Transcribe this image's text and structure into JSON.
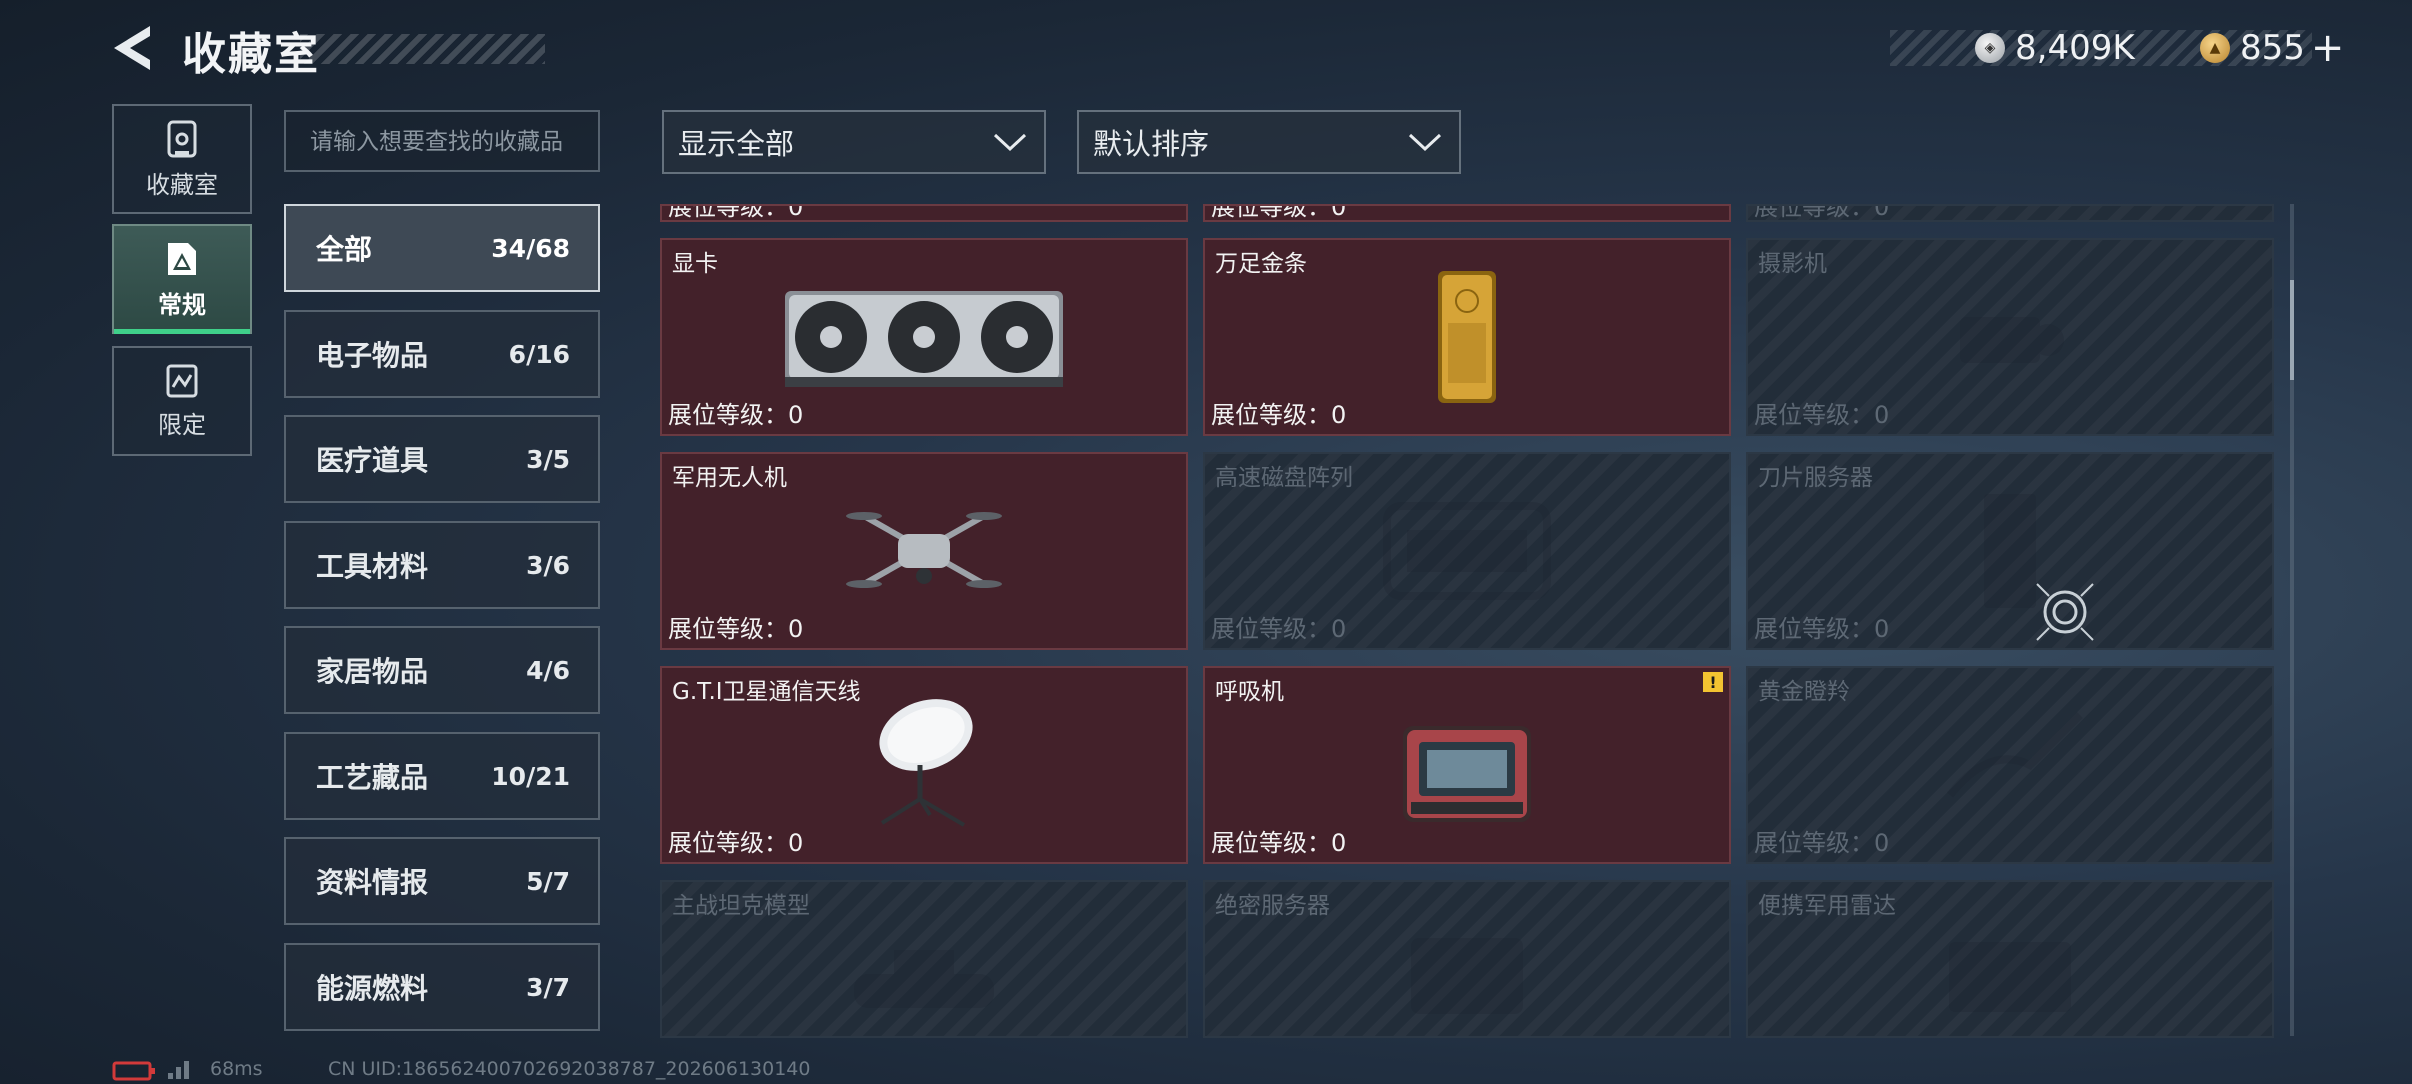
{
  "header": {
    "title": "收藏室",
    "currencies": [
      {
        "icon": "silver-coin-icon",
        "value": "8,409K"
      },
      {
        "icon": "gold-coin-icon",
        "value": "855",
        "add": "+"
      }
    ]
  },
  "side_tabs": [
    {
      "label": "收藏室",
      "icon": "vault-icon"
    },
    {
      "label": "常规",
      "icon": "triangle-card-icon",
      "active": true
    },
    {
      "label": "限定",
      "icon": "limited-icon"
    }
  ],
  "search": {
    "placeholder": "请输入想要查找的收藏品"
  },
  "filters": {
    "display": "显示全部",
    "sort": "默认排序"
  },
  "categories": [
    {
      "name": "全部",
      "count": "34/68",
      "active": true
    },
    {
      "name": "电子物品",
      "count": "6/16"
    },
    {
      "name": "医疗道具",
      "count": "3/5"
    },
    {
      "name": "工具材料",
      "count": "3/6"
    },
    {
      "name": "家居物品",
      "count": "4/6"
    },
    {
      "name": "工艺藏品",
      "count": "10/21"
    },
    {
      "name": "资料情报",
      "count": "5/7"
    },
    {
      "name": "能源燃料",
      "count": "3/7"
    }
  ],
  "level_label": "展位等级：0",
  "partial_row_label": "展位等级：0",
  "items": [
    {
      "name": "显卡",
      "owned": true,
      "icon": "graphics-card-icon"
    },
    {
      "name": "万足金条",
      "owned": true,
      "icon": "gold-bar-icon"
    },
    {
      "name": "摄影机",
      "owned": false,
      "icon": "camera-icon"
    },
    {
      "name": "军用无人机",
      "owned": true,
      "icon": "drone-icon"
    },
    {
      "name": "高速磁盘阵列",
      "owned": false,
      "icon": "disk-array-icon"
    },
    {
      "name": "刀片服务器",
      "owned": false,
      "icon": "blade-server-icon"
    },
    {
      "name": "G.T.I卫星通信天线",
      "owned": true,
      "icon": "satellite-dish-icon"
    },
    {
      "name": "呼吸机",
      "owned": true,
      "icon": "ventilator-icon",
      "warning": "!"
    },
    {
      "name": "黄金瞪羚",
      "owned": false,
      "icon": "gazelle-icon"
    },
    {
      "name": "主战坦克模型",
      "owned": false,
      "icon": "tank-model-icon"
    },
    {
      "name": "绝密服务器",
      "owned": false,
      "icon": "server-icon"
    },
    {
      "name": "便携军用雷达",
      "owned": false,
      "icon": "radar-icon"
    }
  ],
  "status_bar": {
    "ping": "68ms",
    "uid": "CN UID:18656240070269203878​7_202606130140"
  }
}
